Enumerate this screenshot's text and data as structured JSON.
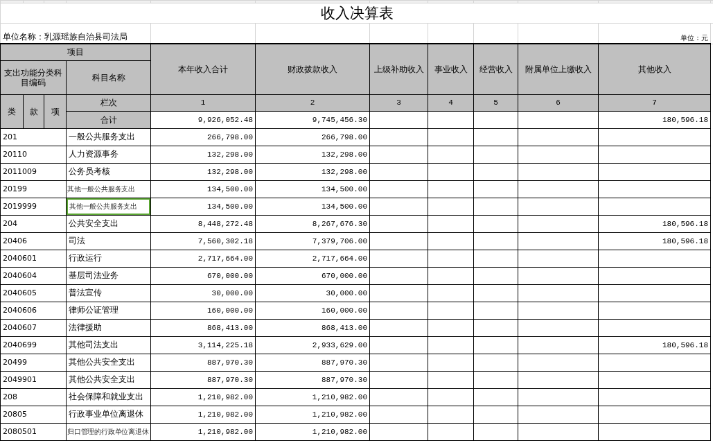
{
  "title": "收入决算表",
  "unit_name": "单位名称：乳源瑶族自治县司法局",
  "unit": "单位：元",
  "header": {
    "item_group": "项目",
    "code_group": "支出功能分类科目编码",
    "name_column": "科目名称",
    "code_levels": [
      "类",
      "款",
      "项"
    ],
    "index_label": "栏次"
  },
  "columns": [
    {
      "title": "本年收入合计",
      "number": "1"
    },
    {
      "title": "财政拨款收入",
      "number": "2"
    },
    {
      "title": "上级补助收入",
      "number": "3"
    },
    {
      "title": "事业收入",
      "number": "4"
    },
    {
      "title": "经营收入",
      "number": "5"
    },
    {
      "title": "附属单位上缴收入",
      "number": "6"
    },
    {
      "title": "其他收入",
      "number": "7"
    }
  ],
  "total": {
    "label": "合计",
    "amounts": {
      "1": "9,926,052.48",
      "2": "9,745,456.30",
      "7": "180,596.18"
    }
  },
  "rows": [
    {
      "code": "201",
      "name": "一般公共服务支出",
      "small_text": false,
      "selected": false,
      "amounts": {
        "1": "266,798.00",
        "2": "266,798.00"
      }
    },
    {
      "code": "20110",
      "name": "人力资源事务",
      "small_text": false,
      "selected": false,
      "amounts": {
        "1": "132,298.00",
        "2": "132,298.00"
      }
    },
    {
      "code": "2011009",
      "name": "公务员考核",
      "small_text": false,
      "selected": false,
      "amounts": {
        "1": "132,298.00",
        "2": "132,298.00"
      }
    },
    {
      "code": "20199",
      "name": "其他一般公共服务支出",
      "small_text": true,
      "selected": false,
      "amounts": {
        "1": "134,500.00",
        "2": "134,500.00"
      }
    },
    {
      "code": "2019999",
      "name": "其他一般公共服务支出",
      "small_text": true,
      "selected": true,
      "amounts": {
        "1": "134,500.00",
        "2": "134,500.00"
      }
    },
    {
      "code": "204",
      "name": "公共安全支出",
      "small_text": false,
      "selected": false,
      "amounts": {
        "1": "8,448,272.48",
        "2": "8,267,676.30",
        "7": "180,596.18"
      }
    },
    {
      "code": "20406",
      "name": "司法",
      "small_text": false,
      "selected": false,
      "amounts": {
        "1": "7,560,302.18",
        "2": "7,379,706.00",
        "7": "180,596.18"
      }
    },
    {
      "code": "2040601",
      "name": "行政运行",
      "small_text": false,
      "selected": false,
      "amounts": {
        "1": "2,717,664.00",
        "2": "2,717,664.00"
      }
    },
    {
      "code": "2040604",
      "name": "基层司法业务",
      "small_text": false,
      "selected": false,
      "amounts": {
        "1": "670,000.00",
        "2": "670,000.00"
      }
    },
    {
      "code": "2040605",
      "name": "普法宣传",
      "small_text": false,
      "selected": false,
      "amounts": {
        "1": "30,000.00",
        "2": "30,000.00"
      }
    },
    {
      "code": "2040606",
      "name": "律师公证管理",
      "small_text": false,
      "selected": false,
      "amounts": {
        "1": "160,000.00",
        "2": "160,000.00"
      }
    },
    {
      "code": "2040607",
      "name": "法律援助",
      "small_text": false,
      "selected": false,
      "amounts": {
        "1": "868,413.00",
        "2": "868,413.00"
      }
    },
    {
      "code": "2040699",
      "name": "其他司法支出",
      "small_text": false,
      "selected": false,
      "amounts": {
        "1": "3,114,225.18",
        "2": "2,933,629.00",
        "7": "180,596.18"
      }
    },
    {
      "code": "20499",
      "name": "其他公共安全支出",
      "small_text": false,
      "selected": false,
      "amounts": {
        "1": "887,970.30",
        "2": "887,970.30"
      }
    },
    {
      "code": "2049901",
      "name": "其他公共安全支出",
      "small_text": false,
      "selected": false,
      "amounts": {
        "1": "887,970.30",
        "2": "887,970.30"
      }
    },
    {
      "code": "208",
      "name": "社会保障和就业支出",
      "small_text": false,
      "selected": false,
      "amounts": {
        "1": "1,210,982.00",
        "2": "1,210,982.00"
      }
    },
    {
      "code": "20805",
      "name": "行政事业单位离退休",
      "small_text": false,
      "selected": false,
      "amounts": {
        "1": "1,210,982.00",
        "2": "1,210,982.00"
      }
    },
    {
      "code": "2080501",
      "name": "归口管理的行政单位离退休",
      "small_text": true,
      "selected": false,
      "amounts": {
        "1": "1,210,982.00",
        "2": "1,210,982.00"
      }
    }
  ]
}
